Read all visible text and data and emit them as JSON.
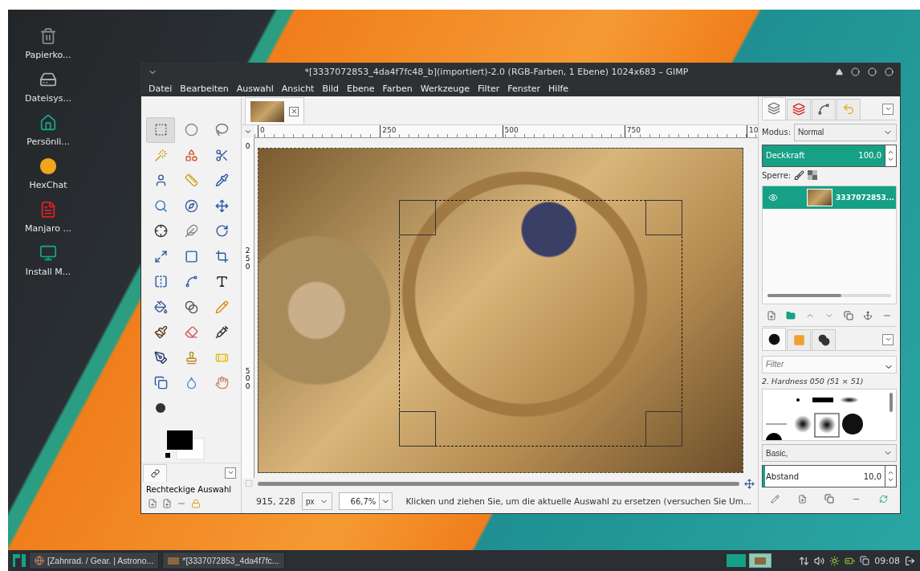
{
  "desktop_icons": [
    {
      "label": "Papierko..."
    },
    {
      "label": "Dateisys..."
    },
    {
      "label": "Persönli..."
    },
    {
      "label": "HexChat"
    },
    {
      "label": "Manjaro ..."
    },
    {
      "label": "Install M..."
    }
  ],
  "window": {
    "title": "*[3337072853_4da4f7fc48_b](importiert)-2.0 (RGB-Farben, 1 Ebene) 1024x683 – GIMP"
  },
  "menu": [
    "Datei",
    "Bearbeiten",
    "Auswahl",
    "Ansicht",
    "Bild",
    "Ebene",
    "Farben",
    "Werkzeuge",
    "Filter",
    "Fenster",
    "Hilfe"
  ],
  "toolbox": {
    "tools": [
      {
        "selected": true
      },
      {
        "selected": false
      },
      {
        "selected": false
      },
      {
        "selected": false
      },
      {
        "selected": false
      },
      {
        "selected": false
      },
      {
        "selected": false
      },
      {
        "selected": false
      },
      {
        "selected": false
      },
      {
        "selected": false
      },
      {
        "selected": false
      },
      {
        "selected": false
      },
      {
        "selected": false
      },
      {
        "selected": false
      },
      {
        "selected": false
      },
      {
        "selected": false
      },
      {
        "selected": false
      },
      {
        "selected": false
      },
      {
        "selected": false
      },
      {
        "selected": false
      },
      {
        "selected": false
      },
      {
        "selected": false
      },
      {
        "selected": false
      },
      {
        "selected": false
      },
      {
        "selected": false
      },
      {
        "selected": false
      },
      {
        "selected": false
      },
      {
        "selected": false
      },
      {
        "selected": false
      },
      {
        "selected": false
      },
      {
        "selected": false
      },
      {
        "selected": false
      },
      {
        "selected": false
      },
      {
        "selected": false
      }
    ],
    "tool_options_title": "Rechteckige Auswahl"
  },
  "canvas": {
    "ruler_marks": [
      "0",
      "250",
      "500",
      "750",
      "10"
    ],
    "vertical_ruler_marks": [
      "0",
      "250",
      "500"
    ]
  },
  "status": {
    "coordinates": "915, 228",
    "unit": "px",
    "zoom": "66,7%",
    "message": "Klicken und ziehen Sie, um die aktuelle Auswahl zu ersetzen (versuchen Sie Um..."
  },
  "layers_dock": {
    "tabs": [
      {
        "selected": true
      },
      {
        "selected": false
      },
      {
        "selected": false
      },
      {
        "selected": false
      }
    ],
    "mode_label": "Modus:",
    "mode": "Normal",
    "opacity": {
      "label": "Deckkraft",
      "value": "100,0",
      "level": 1.0
    },
    "lock_label": "Sperre:",
    "layers": [
      {
        "name": "3337072853...",
        "selected": true,
        "visible": true
      }
    ]
  },
  "brushes_dock": {
    "tabs": [
      {
        "selected": true
      },
      {
        "selected": false
      },
      {
        "selected": false
      }
    ],
    "filter_placeholder": "Filter",
    "brush_name": "2. Hardness 050 (51 × 51)",
    "brush_set": "Basic,",
    "spacing": {
      "label": "Abstand",
      "value": "10,0",
      "level": 0.02
    }
  },
  "taskbar": {
    "tasks": [
      {
        "label": "[Zahnrad. / Gear. | Astrono..."
      },
      {
        "label": "*[3337072853_4da4f7fc..."
      }
    ],
    "clock": "09:08"
  }
}
